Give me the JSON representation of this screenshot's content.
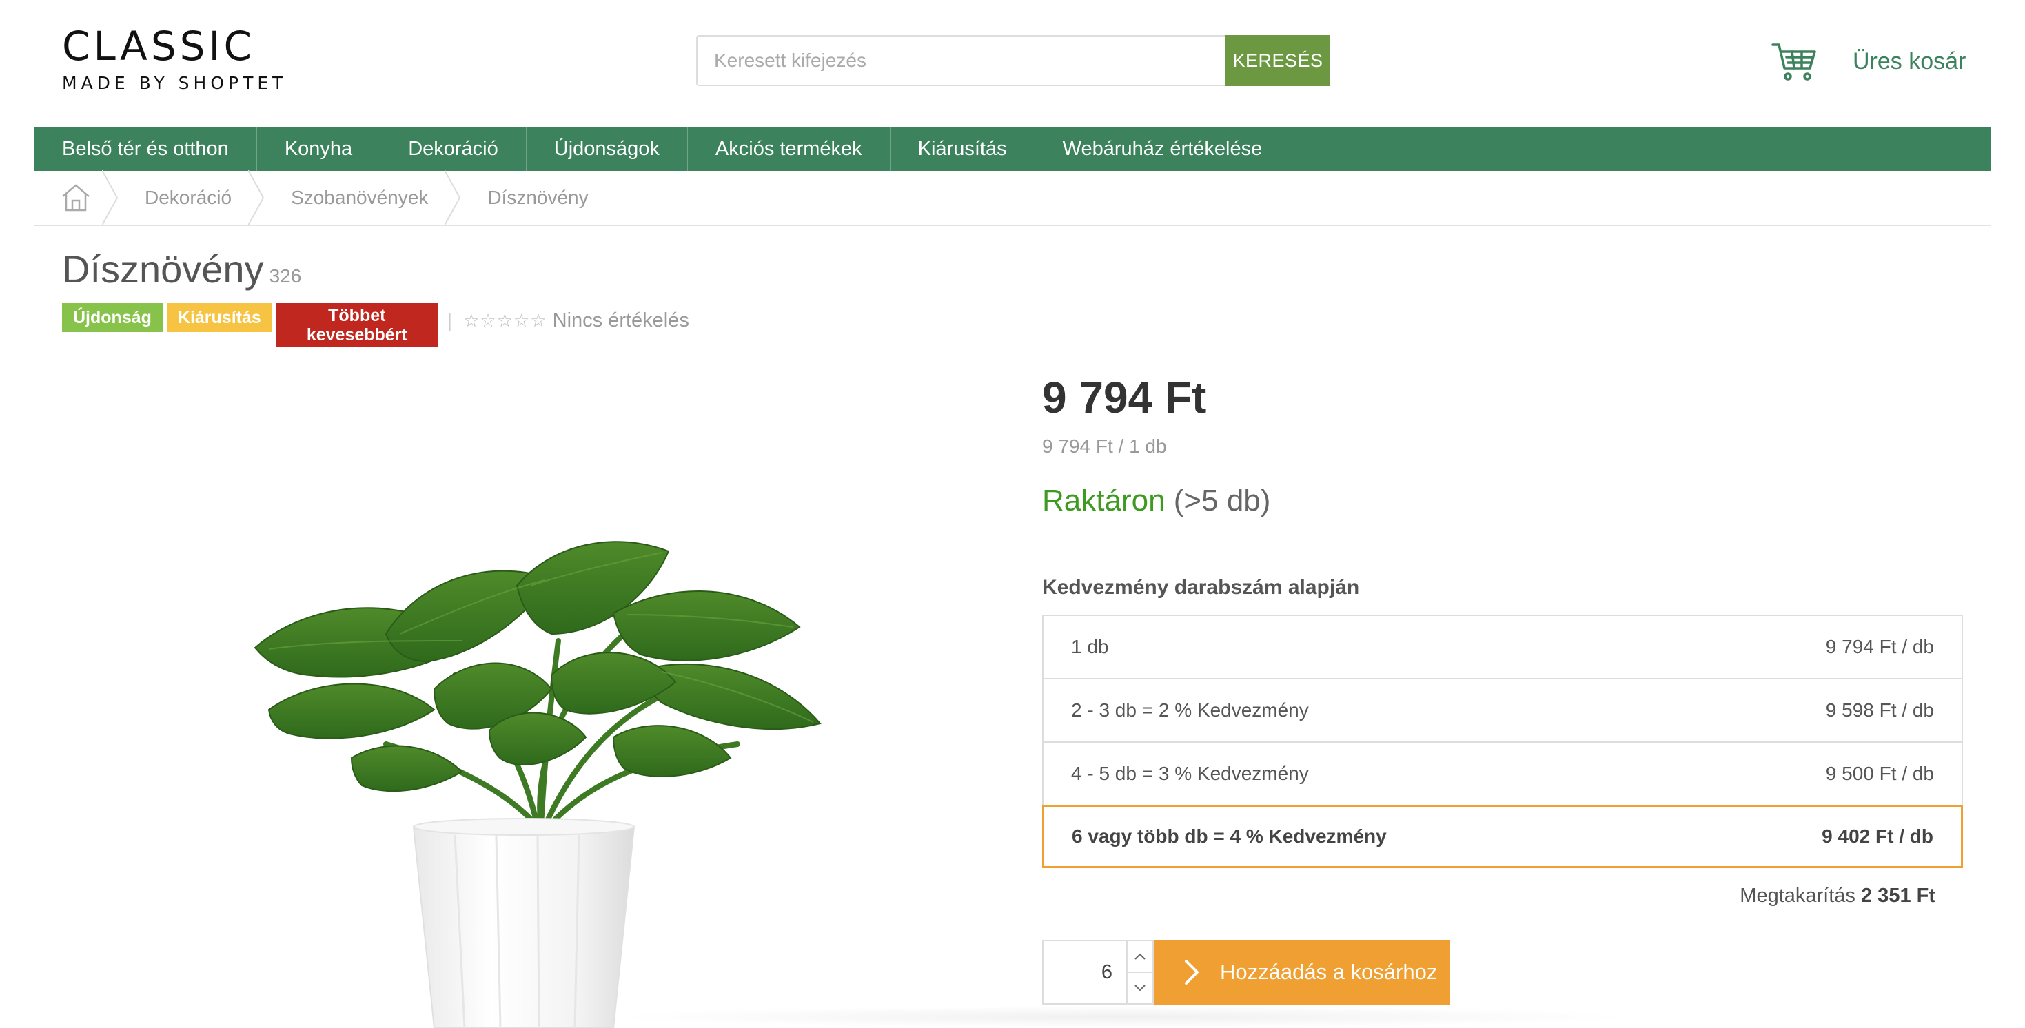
{
  "logo": {
    "title": "CLASSIC",
    "subtitle": "MADE BY SHOPTET"
  },
  "search": {
    "placeholder": "Keresett kifejezés",
    "button_label": "KERESÉS"
  },
  "cart": {
    "icon": "shopping-cart-icon",
    "label": "Üres kosár"
  },
  "nav": {
    "items": [
      "Belső tér és otthon",
      "Konyha",
      "Dekoráció",
      "Újdonságok",
      "Akciós termékek",
      "Kiárusítás",
      "Webáruház értékelése"
    ]
  },
  "breadcrumb": {
    "home_icon": "home-icon",
    "items": [
      "Dekoráció",
      "Szobanövények",
      "Dísznövény"
    ]
  },
  "product": {
    "title": "Dísznövény",
    "code": "326",
    "flags": [
      "Újdonság",
      "Kiárusítás",
      "Többet kevesebbért"
    ],
    "rating_stars": 0,
    "rating_label": "Nincs értékelés",
    "price": "9 794 Ft",
    "unit_price": "9 794 Ft / 1 db",
    "stock_status": "Raktáron",
    "stock_amount": "(>5 db)"
  },
  "discounts": {
    "title": "Kedvezmény darabszám alapján",
    "rows": [
      {
        "label": "1 db",
        "price": "9 794 Ft / db"
      },
      {
        "label": "2 - 3 db = 2 % Kedvezmény",
        "price": "9 598 Ft / db"
      },
      {
        "label": "4 - 5 db = 3 % Kedvezmény",
        "price": "9 500 Ft / db"
      },
      {
        "label": "6 vagy több db = 4 % Kedvezmény",
        "price": "9 402 Ft / db"
      }
    ],
    "active_index": 3,
    "savings_label": "Megtakarítás",
    "savings_value": "2 351 Ft"
  },
  "add_to_cart": {
    "quantity": "6",
    "button_label": "Hozzáadás a kosárhoz"
  },
  "colors": {
    "brand_green": "#3b825d",
    "search_button": "#6b9840",
    "flag_new": "#87c34a",
    "flag_sale": "#f6c342",
    "flag_more": "#c0271f",
    "stock_ok": "#3f9a22",
    "accent_orange": "#f0a033"
  }
}
